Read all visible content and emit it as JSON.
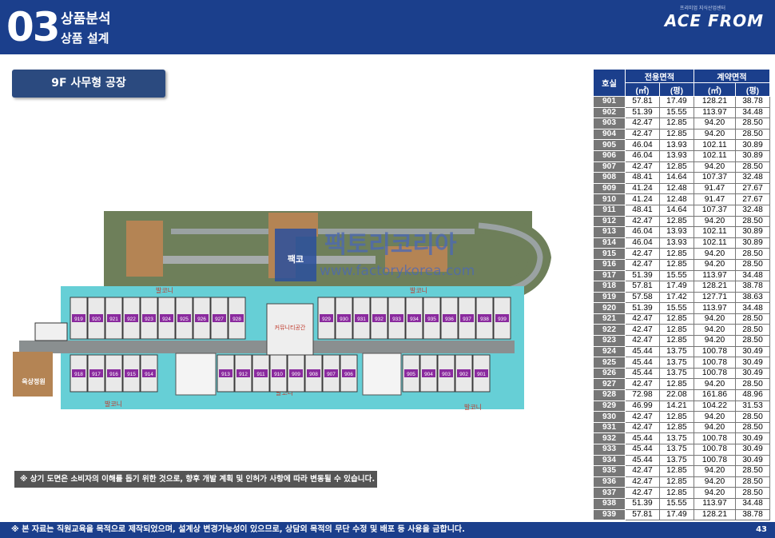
{
  "header": {
    "section_number": "03",
    "section_title": "상품분석",
    "subtitle": "상품 설계",
    "brand": "ACE FROM",
    "brand_sub": "프리미엄 지식산업센터"
  },
  "floor_label": "9F 사무형 공장",
  "watermark": {
    "text": "팩토리코리아",
    "url": "www.factorykorea.com",
    "badge": "팩토리코리아",
    "badge_top": "팩코"
  },
  "plan": {
    "top_units": [
      "919",
      "920",
      "921",
      "922",
      "923",
      "924",
      "925",
      "926",
      "927",
      "928",
      "929",
      "930",
      "931",
      "932",
      "933",
      "934",
      "935",
      "936",
      "937",
      "938",
      "939"
    ],
    "bottom_units": [
      "918",
      "917",
      "916",
      "915",
      "914",
      "913",
      "912",
      "911",
      "910",
      "909",
      "908",
      "907",
      "906",
      "905",
      "904",
      "903",
      "902",
      "901"
    ],
    "balcony_label": "발코니",
    "lounge_label": "커뮤니티공간",
    "roof_label": "옥상정원",
    "ev_label": "EV",
    "colors": {
      "corridor": "#66cfd6",
      "unit_label": "#8a2a9e",
      "garden": "#6e7f5a",
      "deck": "#b48454"
    }
  },
  "note": "※ 상기 도면은 소비자의 이해를 돕기 위한 것으로, 향후 개발 계획 및 인허가 사항에 따라 변동될 수 있습니다.",
  "footer": {
    "text": "※ 본 자료는 직원교육을 목적으로 제작되었으며, 설계상 변경가능성이 있으므로, 상담외 목적의 무단 수정 및 배포 등 사용을 금합니다.",
    "page": "43"
  },
  "table": {
    "headers": {
      "unit": "호실",
      "exclusive": "전용면적",
      "contract": "계약면적",
      "m2": "(㎡)",
      "py": "(평)"
    },
    "rows": [
      [
        "901",
        "57.81",
        "17.49",
        "128.21",
        "38.78"
      ],
      [
        "902",
        "51.39",
        "15.55",
        "113.97",
        "34.48"
      ],
      [
        "903",
        "42.47",
        "12.85",
        "94.20",
        "28.50"
      ],
      [
        "904",
        "42.47",
        "12.85",
        "94.20",
        "28.50"
      ],
      [
        "905",
        "46.04",
        "13.93",
        "102.11",
        "30.89"
      ],
      [
        "906",
        "46.04",
        "13.93",
        "102.11",
        "30.89"
      ],
      [
        "907",
        "42.47",
        "12.85",
        "94.20",
        "28.50"
      ],
      [
        "908",
        "48.41",
        "14.64",
        "107.37",
        "32.48"
      ],
      [
        "909",
        "41.24",
        "12.48",
        "91.47",
        "27.67"
      ],
      [
        "910",
        "41.24",
        "12.48",
        "91.47",
        "27.67"
      ],
      [
        "911",
        "48.41",
        "14.64",
        "107.37",
        "32.48"
      ],
      [
        "912",
        "42.47",
        "12.85",
        "94.20",
        "28.50"
      ],
      [
        "913",
        "46.04",
        "13.93",
        "102.11",
        "30.89"
      ],
      [
        "914",
        "46.04",
        "13.93",
        "102.11",
        "30.89"
      ],
      [
        "915",
        "42.47",
        "12.85",
        "94.20",
        "28.50"
      ],
      [
        "916",
        "42.47",
        "12.85",
        "94.20",
        "28.50"
      ],
      [
        "917",
        "51.39",
        "15.55",
        "113.97",
        "34.48"
      ],
      [
        "918",
        "57.81",
        "17.49",
        "128.21",
        "38.78"
      ],
      [
        "919",
        "57.58",
        "17.42",
        "127.71",
        "38.63"
      ],
      [
        "920",
        "51.39",
        "15.55",
        "113.97",
        "34.48"
      ],
      [
        "921",
        "42.47",
        "12.85",
        "94.20",
        "28.50"
      ],
      [
        "922",
        "42.47",
        "12.85",
        "94.20",
        "28.50"
      ],
      [
        "923",
        "42.47",
        "12.85",
        "94.20",
        "28.50"
      ],
      [
        "924",
        "45.44",
        "13.75",
        "100.78",
        "30.49"
      ],
      [
        "925",
        "45.44",
        "13.75",
        "100.78",
        "30.49"
      ],
      [
        "926",
        "45.44",
        "13.75",
        "100.78",
        "30.49"
      ],
      [
        "927",
        "42.47",
        "12.85",
        "94.20",
        "28.50"
      ],
      [
        "928",
        "72.98",
        "22.08",
        "161.86",
        "48.96"
      ],
      [
        "929",
        "46.99",
        "14.21",
        "104.22",
        "31.53"
      ],
      [
        "930",
        "42.47",
        "12.85",
        "94.20",
        "28.50"
      ],
      [
        "931",
        "42.47",
        "12.85",
        "94.20",
        "28.50"
      ],
      [
        "932",
        "45.44",
        "13.75",
        "100.78",
        "30.49"
      ],
      [
        "933",
        "45.44",
        "13.75",
        "100.78",
        "30.49"
      ],
      [
        "934",
        "45.44",
        "13.75",
        "100.78",
        "30.49"
      ],
      [
        "935",
        "42.47",
        "12.85",
        "94.20",
        "28.50"
      ],
      [
        "936",
        "42.47",
        "12.85",
        "94.20",
        "28.50"
      ],
      [
        "937",
        "42.47",
        "12.85",
        "94.20",
        "28.50"
      ],
      [
        "938",
        "51.39",
        "15.55",
        "113.97",
        "34.48"
      ],
      [
        "939",
        "57.81",
        "17.49",
        "128.21",
        "38.78"
      ]
    ]
  }
}
